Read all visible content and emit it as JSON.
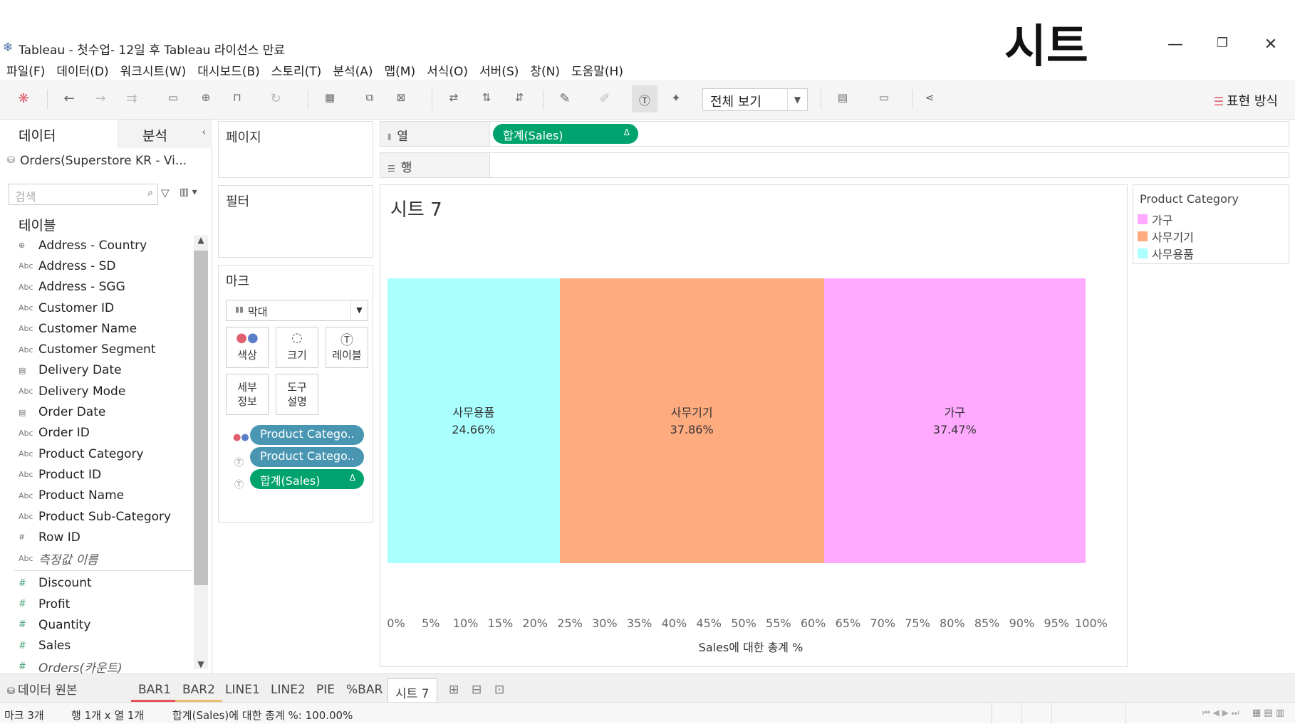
{
  "window": {
    "title": "Tableau - 첫수업- 12일 후 Tableau 라이선스 만료",
    "overlay_title": "시트",
    "minimize": "—",
    "restore": "❐",
    "close": "✕"
  },
  "menu": [
    "파일(F)",
    "데이터(D)",
    "워크시트(W)",
    "대시보드(B)",
    "스토리(T)",
    "분석(A)",
    "맵(M)",
    "서식(O)",
    "서버(S)",
    "창(N)",
    "도움말(H)"
  ],
  "toolbar": {
    "view_select": "전체 보기",
    "show_me": "표현 방식"
  },
  "data_pane": {
    "tab_data": "데이터",
    "tab_analysis": "분석",
    "datasource": "Orders(Superstore KR - Vi...",
    "search_placeholder": "검색",
    "tables_header": "테이블",
    "dimensions": [
      {
        "type": "geo",
        "name": "Address - Country"
      },
      {
        "type": "Abc",
        "name": "Address - SD"
      },
      {
        "type": "Abc",
        "name": "Address - SGG"
      },
      {
        "type": "Abc",
        "name": "Customer ID"
      },
      {
        "type": "Abc",
        "name": "Customer Name"
      },
      {
        "type": "Abc",
        "name": "Customer Segment"
      },
      {
        "type": "date",
        "name": "Delivery Date"
      },
      {
        "type": "Abc",
        "name": "Delivery Mode"
      },
      {
        "type": "date",
        "name": "Order Date"
      },
      {
        "type": "Abc",
        "name": "Order ID"
      },
      {
        "type": "Abc",
        "name": "Product Category"
      },
      {
        "type": "Abc",
        "name": "Product ID"
      },
      {
        "type": "Abc",
        "name": "Product Name"
      },
      {
        "type": "Abc",
        "name": "Product Sub-Category"
      },
      {
        "type": "#",
        "name": "Row ID"
      },
      {
        "type": "Abc",
        "name": "측정값 이름",
        "italic": true
      }
    ],
    "measures": [
      {
        "type": "#",
        "name": "Discount"
      },
      {
        "type": "#",
        "name": "Profit"
      },
      {
        "type": "#",
        "name": "Quantity"
      },
      {
        "type": "#",
        "name": "Sales"
      },
      {
        "type": "#",
        "name": "Orders(카운트)",
        "italic": true
      }
    ]
  },
  "cards": {
    "pages": "페이지",
    "filters": "필터",
    "marks": "마크",
    "mark_type": "막대",
    "mark_buttons": {
      "color": "색상",
      "size": "크기",
      "label": "레이블",
      "detail_1": "세부",
      "detail_2": "정보",
      "tooltip_1": "도구",
      "tooltip_2": "설명"
    },
    "mark_pills": [
      "Product Catego..",
      "Product Catego..",
      "합계(Sales)"
    ],
    "pill_delta": "Δ"
  },
  "shelves": {
    "columns_label": "열",
    "rows_label": "행",
    "columns_pill": "합계(Sales)"
  },
  "sheet": {
    "title": "시트 7"
  },
  "chart_data": {
    "type": "bar",
    "orientation": "horizontal-stacked-percent",
    "categories": [
      "사무용품",
      "사무기기",
      "가구"
    ],
    "values": [
      24.66,
      37.86,
      37.47
    ],
    "value_labels": [
      "24.66%",
      "37.86%",
      "37.47%"
    ],
    "colors": [
      "#aaffff",
      "#ffab80",
      "#ffaaff"
    ],
    "xlim": [
      0,
      100
    ],
    "x_ticks": [
      "0%",
      "5%",
      "10%",
      "15%",
      "20%",
      "25%",
      "30%",
      "35%",
      "40%",
      "45%",
      "50%",
      "55%",
      "60%",
      "65%",
      "70%",
      "75%",
      "80%",
      "85%",
      "90%",
      "95%",
      "100%"
    ],
    "xlabel": "Sales에 대한 총계 %",
    "legend_title": "Product Category",
    "legend": [
      {
        "name": "가구",
        "color": "#ffaaff"
      },
      {
        "name": "사무기기",
        "color": "#ffab80"
      },
      {
        "name": "사무용품",
        "color": "#aaffff"
      }
    ],
    "legend_position": "right"
  },
  "sheet_tabs": {
    "datasource_tab": "데이터 원본",
    "tabs": [
      {
        "label": "BAR1",
        "underline": "#e8505b"
      },
      {
        "label": "BAR2",
        "underline": "#e8c070"
      },
      {
        "label": "LINE1",
        "underline": ""
      },
      {
        "label": "LINE2",
        "underline": ""
      },
      {
        "label": "PIE",
        "underline": ""
      },
      {
        "label": "%BAR",
        "underline": ""
      },
      {
        "label": "시트 7",
        "underline": "",
        "active": true
      }
    ]
  },
  "status": {
    "marks": "마크 3개",
    "rows_cols": "행 1개 x 열 1개",
    "summary": "합계(Sales)에 대한 총계 %: 100.00%"
  }
}
